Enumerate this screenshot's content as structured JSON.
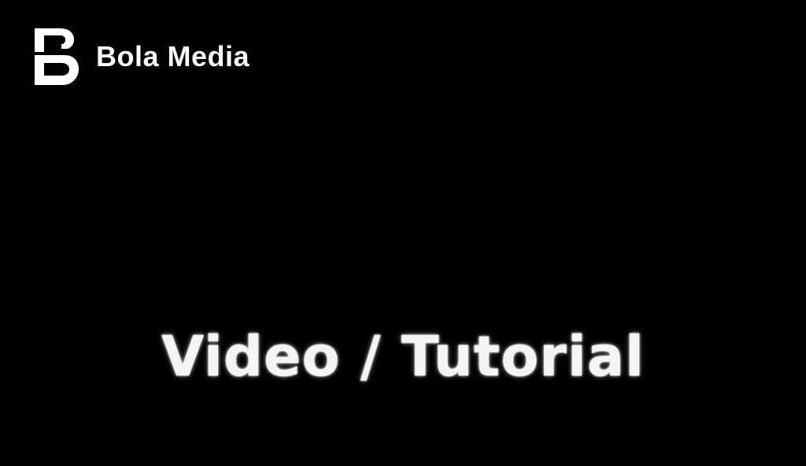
{
  "brand": {
    "logo_icon": "bola-media-b-logo-icon",
    "name": "Bola Media"
  },
  "headline": {
    "text": "Video / Tutorial"
  },
  "colors": {
    "background": "#000000",
    "foreground": "#ffffff"
  }
}
